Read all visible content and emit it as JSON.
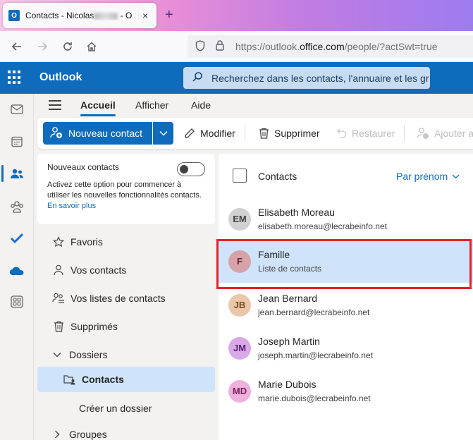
{
  "browser": {
    "tab_icon_letter": "O",
    "tab_title_prefix": "Contacts - Nicolas",
    "tab_title_suffix": "- O",
    "tab_close": "×",
    "new_tab": "+",
    "url_prefix": "https://outlook.",
    "url_domain": "office.com",
    "url_path": "/people/?actSwt=true"
  },
  "header": {
    "app_name": "Outlook",
    "search_placeholder": "Recherchez dans les contacts, l'annuaire et les gr"
  },
  "ribbon": {
    "tabs": [
      {
        "label": "Accueil",
        "active": true
      },
      {
        "label": "Afficher",
        "active": false
      },
      {
        "label": "Aide",
        "active": false
      }
    ],
    "new_contact": "Nouveau contact",
    "edit": "Modifier",
    "delete": "Supprimer",
    "restore": "Restaurer",
    "add_to": "Ajouter au"
  },
  "new_contacts_card": {
    "title": "Nouveaux contacts",
    "toggle_on": false,
    "description": "Activez cette option pour commencer à utiliser les nouvelles fonctionnalités contacts.",
    "learn_more": "En savoir plus"
  },
  "nav": {
    "favorites": "Favoris",
    "your_contacts": "Vos contacts",
    "contact_lists": "Vos listes de contacts",
    "deleted": "Supprimés",
    "folders": "Dossiers",
    "contacts_folder": "Contacts",
    "create_folder": "Créer un dossier",
    "groups": "Groupes"
  },
  "list": {
    "title": "Contacts",
    "sort_label": "Par prénom",
    "contacts": [
      {
        "initials": "EM",
        "name": "Elisabeth Moreau",
        "sub": "elisabeth.moreau@lecrabeinfo.net",
        "bg": "#d1d1d1",
        "fg": "#424242"
      },
      {
        "initials": "F",
        "name": "Famille",
        "sub": "Liste de contacts",
        "bg": "#d6a3a8",
        "fg": "#6b1f2b"
      },
      {
        "initials": "JB",
        "name": "Jean Bernard",
        "sub": "jean.bernard@lecrabeinfo.net",
        "bg": "#e9c7a8",
        "fg": "#7a4a21"
      },
      {
        "initials": "JM",
        "name": "Joseph Martin",
        "sub": "joseph.martin@lecrabeinfo.net",
        "bg": "#d8a9e6",
        "fg": "#5c1f75"
      },
      {
        "initials": "MD",
        "name": "Marie Dubois",
        "sub": "marie.dubois@lecrabeinfo.net",
        "bg": "#eeb1dc",
        "fg": "#7a1e5c"
      }
    ]
  },
  "colors": {
    "accent": "#0f6cbd",
    "selection": "#cfe4fa",
    "highlight_border": "#e0242b"
  }
}
